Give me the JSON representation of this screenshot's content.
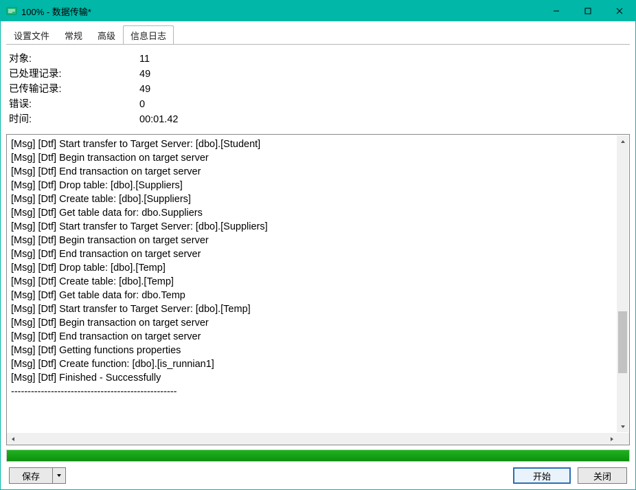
{
  "window": {
    "title": "100% - 数据传输*"
  },
  "tabs": [
    {
      "label": "设置文件",
      "active": false
    },
    {
      "label": "常规",
      "active": false
    },
    {
      "label": "高级",
      "active": false
    },
    {
      "label": "信息日志",
      "active": true
    }
  ],
  "summary": {
    "labels": {
      "objects": "对象:",
      "processed": "已处理记录:",
      "transferred": "已传输记录:",
      "errors": "错误:",
      "time": "时间:"
    },
    "values": {
      "objects": "11",
      "processed": "49",
      "transferred": "49",
      "errors": "0",
      "time": "00:01.42"
    }
  },
  "log": {
    "lines": [
      "[Msg] [Dtf] Start transfer to Target Server: [dbo].[Student]",
      "[Msg] [Dtf] Begin transaction on target server",
      "[Msg] [Dtf] End transaction on target server",
      "[Msg] [Dtf] Drop table: [dbo].[Suppliers]",
      "[Msg] [Dtf] Create table: [dbo].[Suppliers]",
      "[Msg] [Dtf] Get table data for: dbo.Suppliers",
      "[Msg] [Dtf] Start transfer to Target Server: [dbo].[Suppliers]",
      "[Msg] [Dtf] Begin transaction on target server",
      "[Msg] [Dtf] End transaction on target server",
      "[Msg] [Dtf] Drop table: [dbo].[Temp]",
      "[Msg] [Dtf] Create table: [dbo].[Temp]",
      "[Msg] [Dtf] Get table data for: dbo.Temp",
      "[Msg] [Dtf] Start transfer to Target Server: [dbo].[Temp]",
      "[Msg] [Dtf] Begin transaction on target server",
      "[Msg] [Dtf] End transaction on target server",
      "[Msg] [Dtf] Getting functions properties",
      "[Msg] [Dtf] Create function: [dbo].[is_runnian1]",
      "[Msg] [Dtf] Finished - Successfully",
      "--------------------------------------------------"
    ]
  },
  "progress": {
    "percent": 100
  },
  "buttons": {
    "save": "保存",
    "start": "开始",
    "close": "关闭"
  }
}
